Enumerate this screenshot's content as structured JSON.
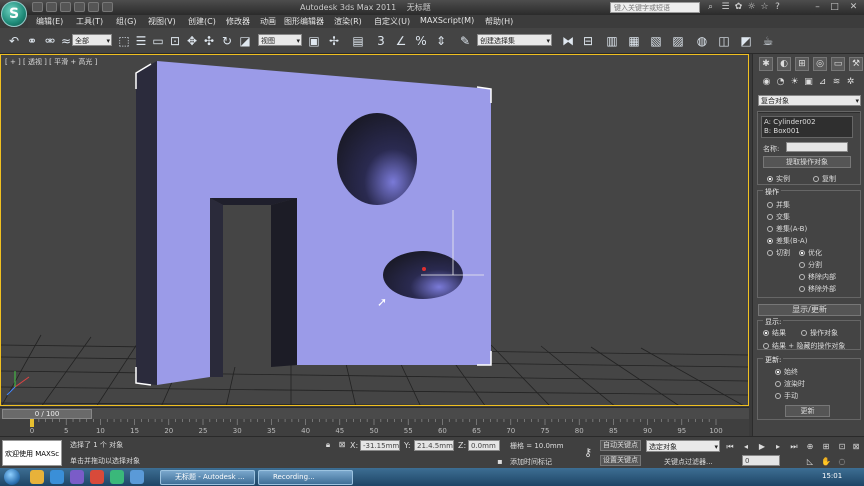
{
  "app": {
    "logo": "S",
    "title": "Autodesk 3ds Max  2011",
    "file": "无标题",
    "search_placeholder": "键入关键字或短语"
  },
  "menu": [
    "编辑(E)",
    "工具(T)",
    "组(G)",
    "视图(V)",
    "创建(C)",
    "修改器",
    "动画",
    "图形编辑器",
    "渲染(R)",
    "自定义(U)",
    "MAXScript(M)",
    "帮助(H)"
  ],
  "toolbar": {
    "filter_dropdown": "全部",
    "ref_coord_dropdown": "视图",
    "selection_set_dropdown": "创建选择集"
  },
  "viewport": {
    "label": "[ + ] [ 透视 ] [ 平滑 + 高光 ]",
    "object_color": "#9b9be8"
  },
  "command_panel": {
    "category_dropdown": "复合对象",
    "operands": [
      "A: Cylinder002",
      "B: Box001"
    ],
    "name_label": "名称:",
    "pick_button": "提取操作对象",
    "instance_label": "实例",
    "copy_label": "复制",
    "operation_title": "操作",
    "operations": [
      "并集",
      "交集",
      "差集(A-B)",
      "差集(B-A)",
      "切割"
    ],
    "cut_options": [
      "优化",
      "分割",
      "移除内部",
      "移除外部"
    ],
    "display_update_title": "显示/更新",
    "display_title": "显示:",
    "display_options": [
      "结果",
      "操作对象",
      "结果 + 隐藏的操作对象"
    ],
    "update_title": "更新:",
    "update_options": [
      "始终",
      "渲染时",
      "手动"
    ],
    "update_button": "更新"
  },
  "timeline": {
    "frame_display": "0 / 100",
    "ticks": [
      "0",
      "5",
      "10",
      "15",
      "20",
      "25",
      "30",
      "35",
      "40",
      "45",
      "50",
      "55",
      "60",
      "65",
      "70",
      "75",
      "80",
      "85",
      "90",
      "95",
      "100"
    ]
  },
  "status": {
    "welcome": "欢迎使用 MAXSc",
    "selected": "选择了 1 个 对象",
    "prompt": "单击并拖动以选择对象",
    "x_label": "X:",
    "x_value": "-31.15mm",
    "y_label": "Y:",
    "y_value": "21.4.5mm",
    "z_label": "Z:",
    "z_value": "0.0mm",
    "grid": "栅格 = 10.0mm",
    "add_time_tag": "添加时间标记",
    "auto_key": "自动关键点",
    "selected_object_dropdown": "选定对象",
    "set_key": "设置关键点",
    "key_filters": "关键点过滤器...",
    "frame_value": "0"
  },
  "taskbar": {
    "tasks": [
      "无标题 - Autodesk ...",
      "Recording..."
    ],
    "clock": "15:01"
  }
}
